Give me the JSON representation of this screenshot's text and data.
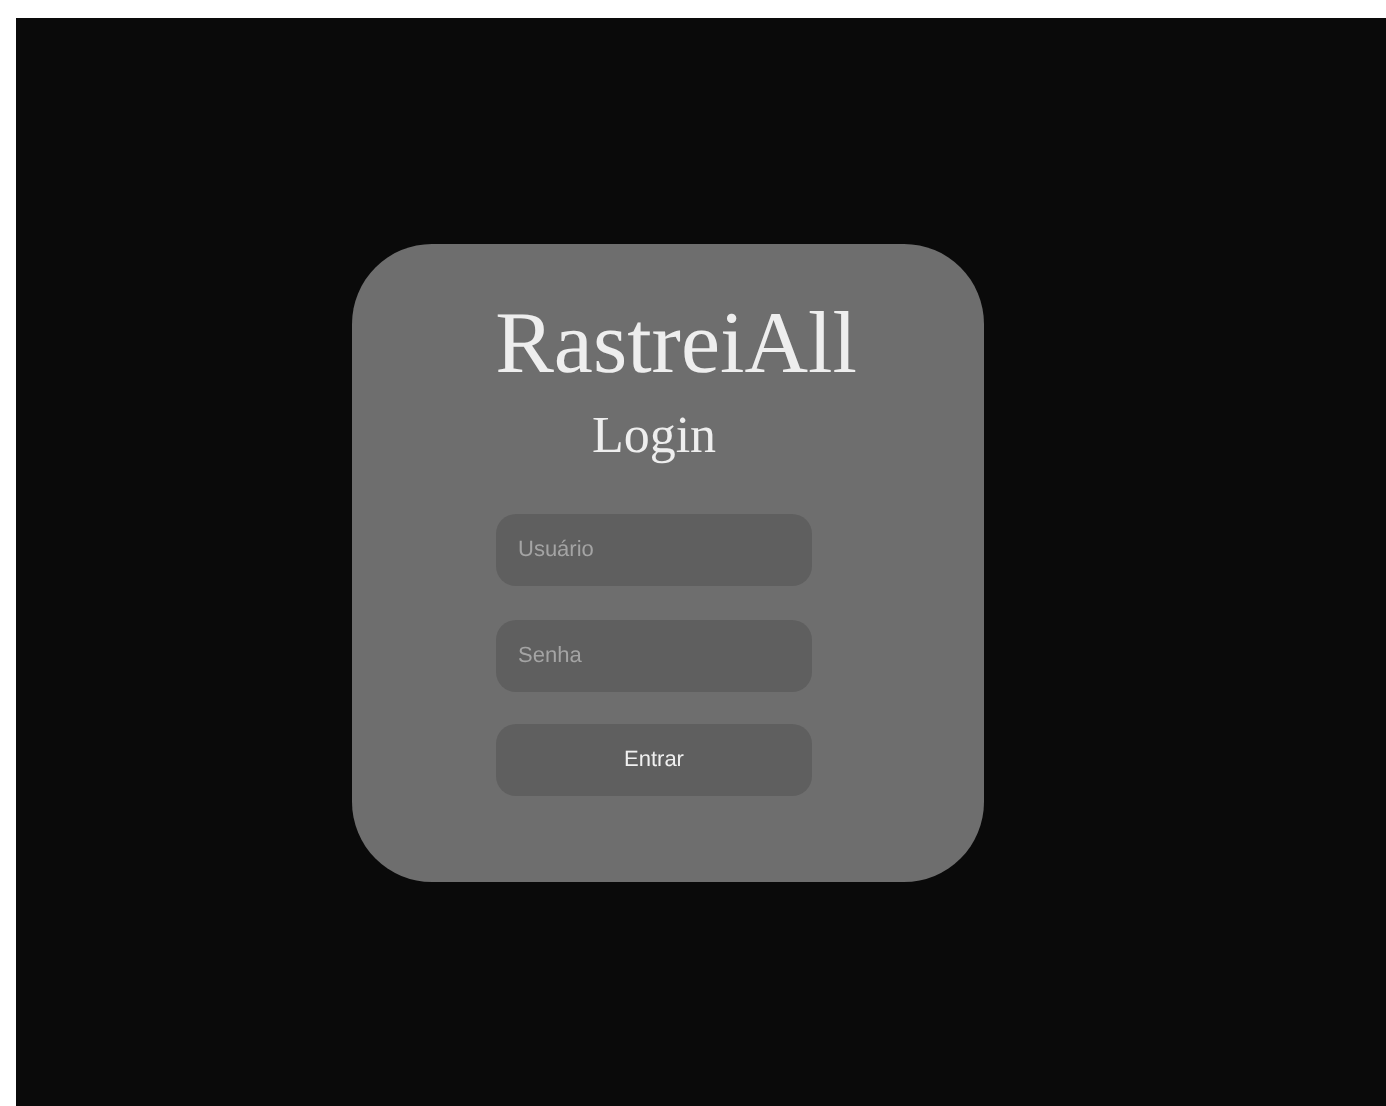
{
  "app_title": "RastreiAll",
  "heading": "Login",
  "fields": [
    {
      "placeholder": "Usuário"
    },
    {
      "placeholder": "Senha"
    }
  ],
  "submit_button": "Entrar"
}
